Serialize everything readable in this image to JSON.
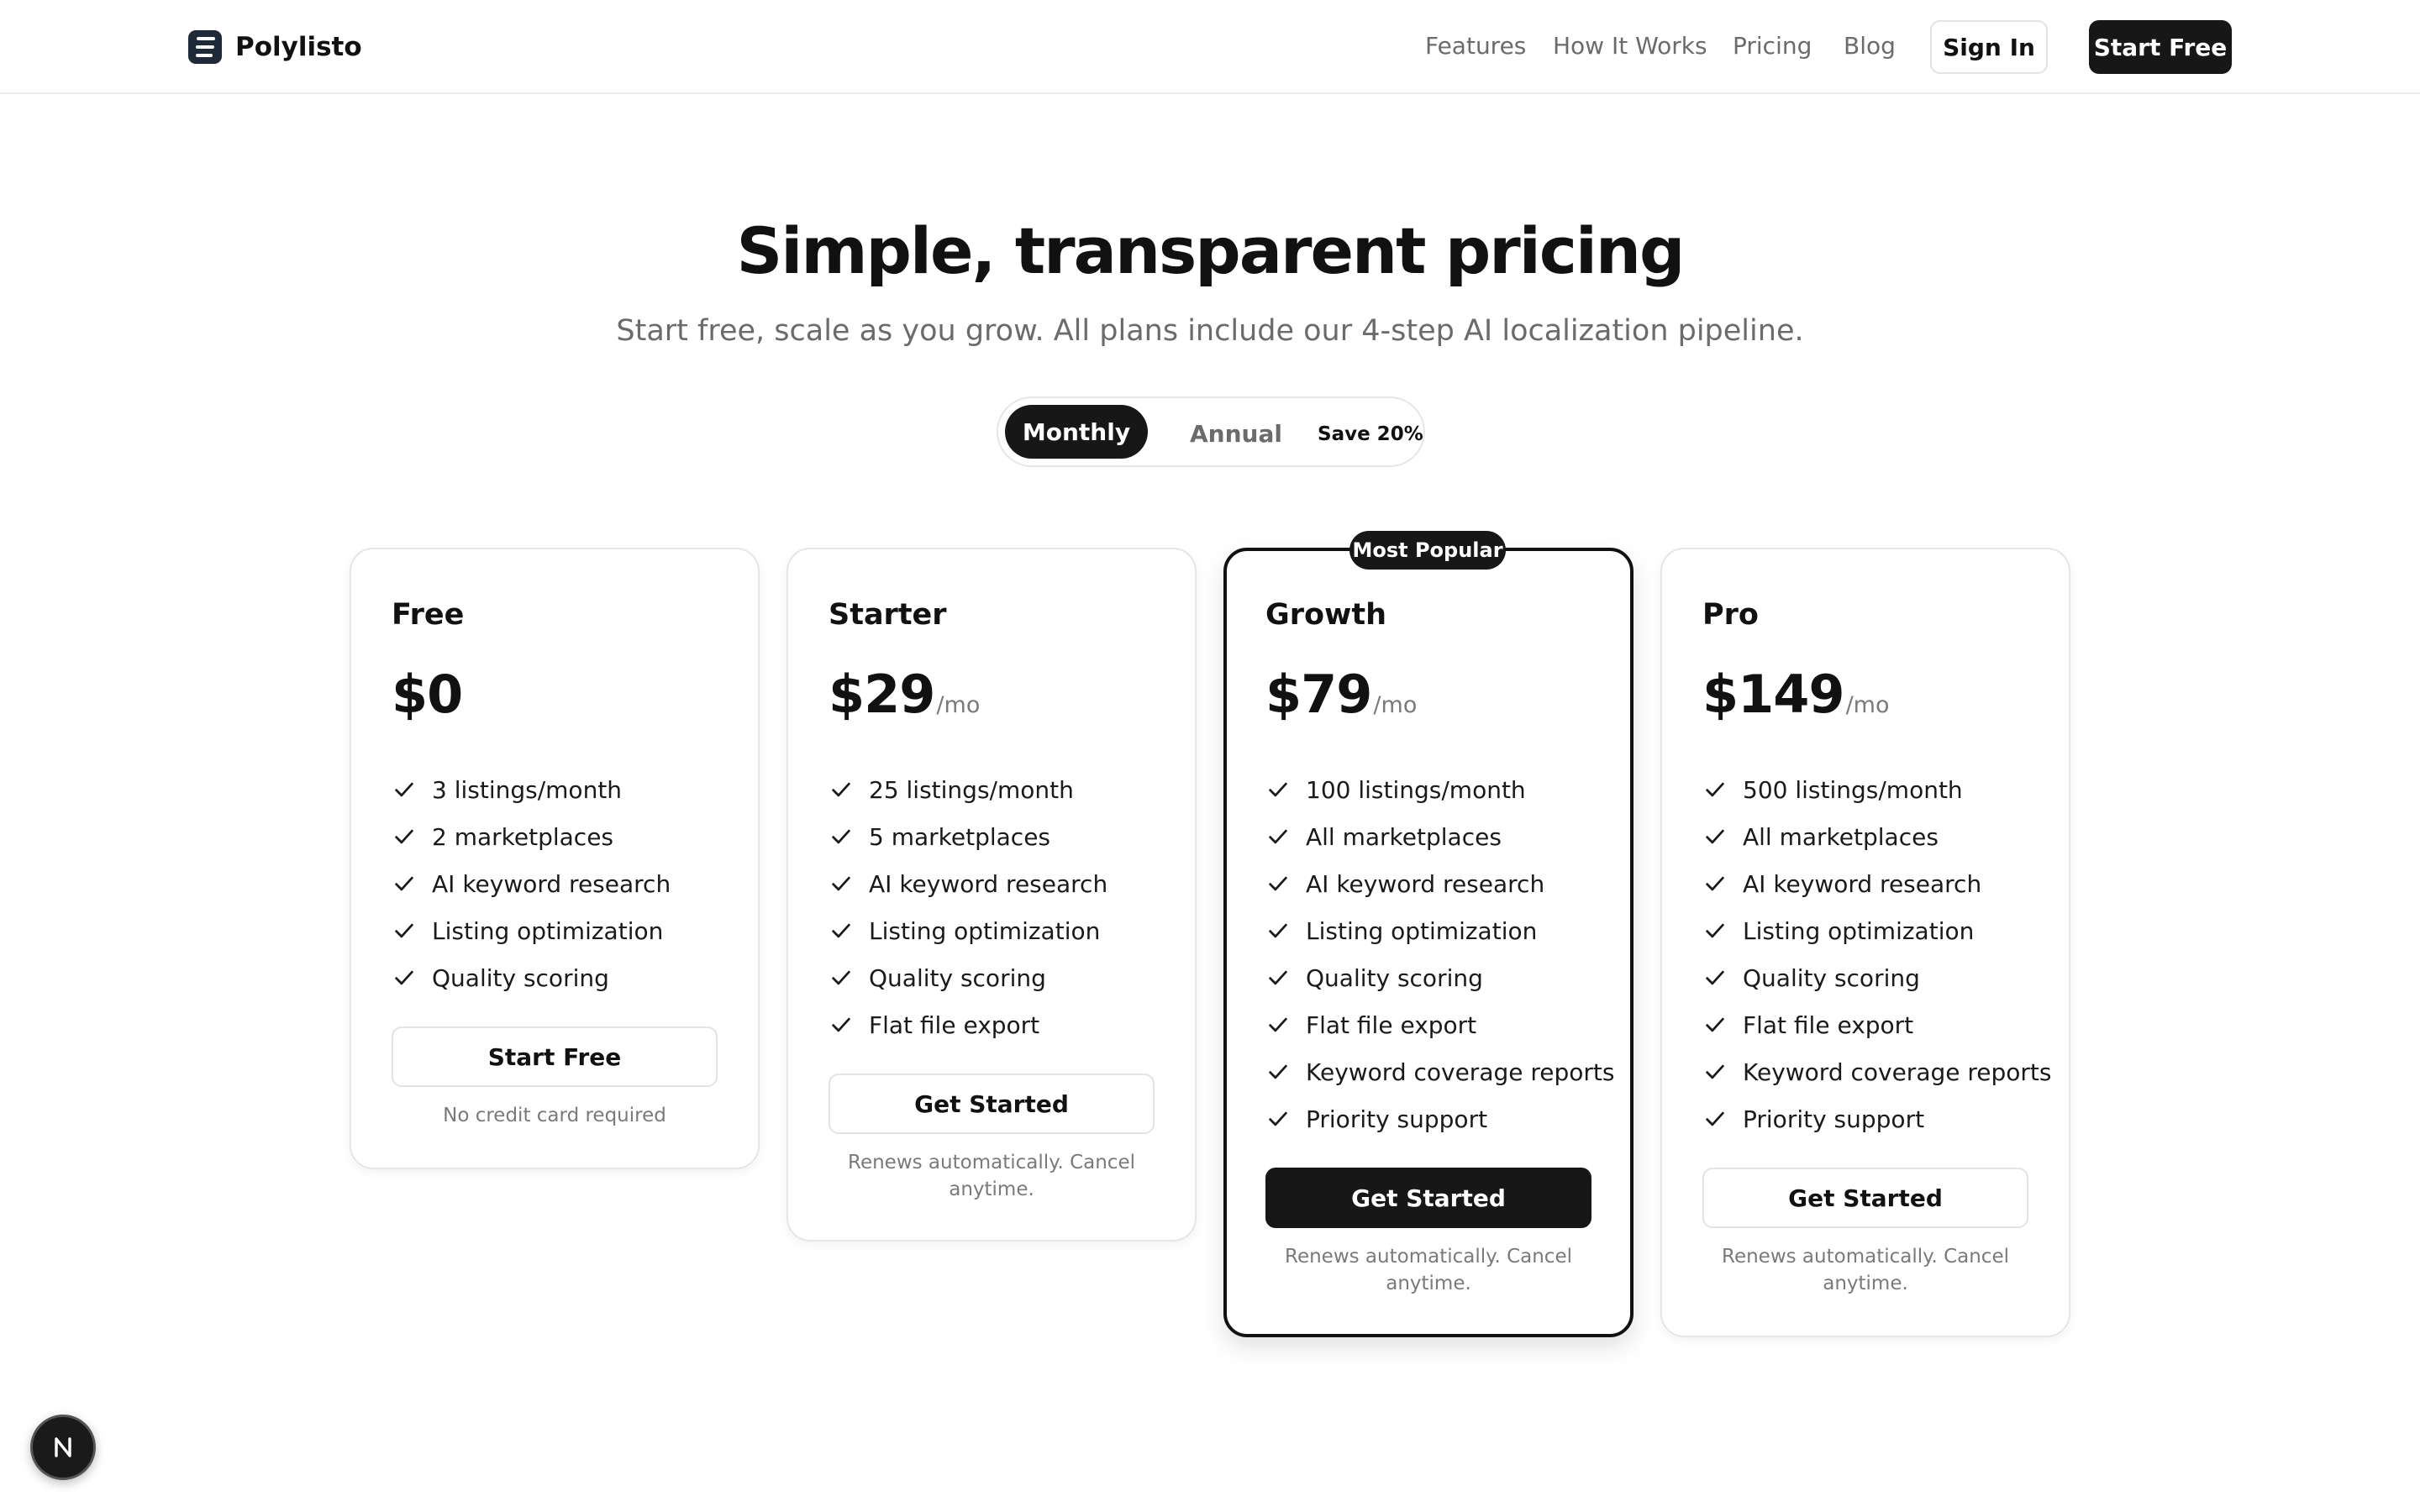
{
  "header": {
    "brand": "Polylisto",
    "nav": [
      "Features",
      "How It Works",
      "Pricing",
      "Blog"
    ],
    "sign_in": "Sign In",
    "start_free": "Start Free"
  },
  "hero": {
    "title": "Simple, transparent pricing",
    "subtitle": "Start free, scale as you grow. All plans include our 4-step AI localization pipeline."
  },
  "billing_toggle": {
    "monthly": "Monthly",
    "annual": "Annual",
    "save": "Save 20%",
    "selected": "Monthly"
  },
  "plans": [
    {
      "name": "Free",
      "price": "$0",
      "period": "",
      "features": [
        "3 listings/month",
        "2 marketplaces",
        "AI keyword research",
        "Listing optimization",
        "Quality scoring"
      ],
      "cta": "Start Free",
      "note": "No credit card required"
    },
    {
      "name": "Starter",
      "price": "$29",
      "period": "/mo",
      "features": [
        "25 listings/month",
        "5 marketplaces",
        "AI keyword research",
        "Listing optimization",
        "Quality scoring",
        "Flat file export"
      ],
      "cta": "Get Started",
      "note": "Renews automatically. Cancel anytime."
    },
    {
      "name": "Growth",
      "price": "$79",
      "period": "/mo",
      "badge": "Most Popular",
      "features": [
        "100 listings/month",
        "All marketplaces",
        "AI keyword research",
        "Listing optimization",
        "Quality scoring",
        "Flat file export",
        "Keyword coverage reports",
        "Priority support"
      ],
      "cta": "Get Started",
      "note": "Renews automatically. Cancel anytime."
    },
    {
      "name": "Pro",
      "price": "$149",
      "period": "/mo",
      "features": [
        "500 listings/month",
        "All marketplaces",
        "AI keyword research",
        "Listing optimization",
        "Quality scoring",
        "Flat file export",
        "Keyword coverage reports",
        "Priority support"
      ],
      "cta": "Get Started",
      "note": "Renews automatically. Cancel anytime."
    }
  ],
  "icons": {
    "logo": "list-lines-icon",
    "check": "check-icon",
    "dev_tools": "next-logo-icon"
  },
  "colors": {
    "primary": "#171717",
    "muted_text": "#6b6b6b",
    "border": "#e6e6e6",
    "logo_bg": "#1e2a3a"
  }
}
